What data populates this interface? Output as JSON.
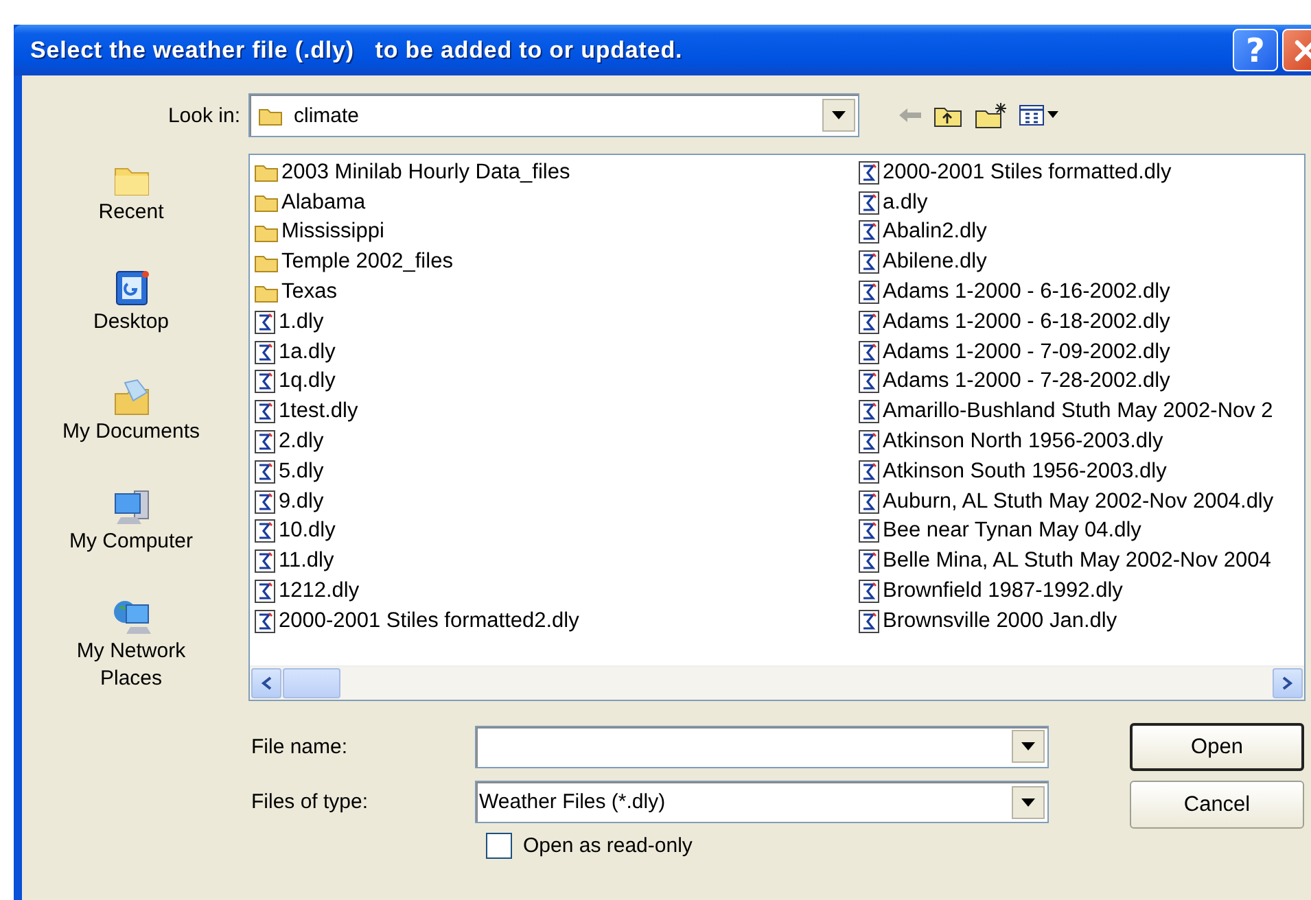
{
  "window": {
    "title": "Select the weather file (.dly)   to be added to or updated.",
    "help_button": "?"
  },
  "look_in": {
    "label": "Look in:",
    "value": "climate"
  },
  "places": [
    {
      "label": "Recent",
      "kind": "recent"
    },
    {
      "label": "Desktop",
      "kind": "desktop"
    },
    {
      "label": "My Documents",
      "kind": "documents"
    },
    {
      "label": "My Computer",
      "kind": "computer"
    },
    {
      "label": "My Network Places",
      "kind": "network"
    }
  ],
  "files": [
    {
      "name": "2003 Minilab Hourly Data_files",
      "kind": "folder"
    },
    {
      "name": "Alabama",
      "kind": "folder"
    },
    {
      "name": "Mississippi",
      "kind": "folder"
    },
    {
      "name": "Temple 2002_files",
      "kind": "folder"
    },
    {
      "name": "Texas",
      "kind": "folder"
    },
    {
      "name": "1.dly",
      "kind": "file"
    },
    {
      "name": "1a.dly",
      "kind": "file"
    },
    {
      "name": "1q.dly",
      "kind": "file"
    },
    {
      "name": "1test.dly",
      "kind": "file"
    },
    {
      "name": "2.dly",
      "kind": "file"
    },
    {
      "name": "5.dly",
      "kind": "file"
    },
    {
      "name": "9.dly",
      "kind": "file"
    },
    {
      "name": "10.dly",
      "kind": "file"
    },
    {
      "name": "11.dly",
      "kind": "file"
    },
    {
      "name": "1212.dly",
      "kind": "file"
    },
    {
      "name": "2000-2001 Stiles formatted2.dly",
      "kind": "file"
    },
    {
      "name": "2000-2001 Stiles formatted.dly",
      "kind": "file"
    },
    {
      "name": "a.dly",
      "kind": "file"
    },
    {
      "name": "Abalin2.dly",
      "kind": "file"
    },
    {
      "name": "Abilene.dly",
      "kind": "file"
    },
    {
      "name": "Adams 1-2000 - 6-16-2002.dly",
      "kind": "file"
    },
    {
      "name": "Adams 1-2000 - 6-18-2002.dly",
      "kind": "file"
    },
    {
      "name": "Adams 1-2000 - 7-09-2002.dly",
      "kind": "file"
    },
    {
      "name": "Adams 1-2000 - 7-28-2002.dly",
      "kind": "file"
    },
    {
      "name": "Amarillo-Bushland Stuth May 2002-Nov 2",
      "kind": "file"
    },
    {
      "name": "Atkinson North 1956-2003.dly",
      "kind": "file"
    },
    {
      "name": "Atkinson South 1956-2003.dly",
      "kind": "file"
    },
    {
      "name": "Auburn, AL Stuth May 2002-Nov 2004.dly",
      "kind": "file"
    },
    {
      "name": "Bee near Tynan May 04.dly",
      "kind": "file"
    },
    {
      "name": "Belle Mina, AL  Stuth May 2002-Nov 2004",
      "kind": "file"
    },
    {
      "name": "Brownfield 1987-1992.dly",
      "kind": "file"
    },
    {
      "name": "Brownsville 2000 Jan.dly",
      "kind": "file"
    }
  ],
  "file_name": {
    "label": "File name:"
  },
  "file_type": {
    "label": "Files of type:",
    "value": "Weather Files (*.dly)"
  },
  "read_only": {
    "label": "Open as read-only",
    "checked": false
  },
  "buttons": [
    {
      "label": "Open",
      "default": true
    },
    {
      "label": "Cancel",
      "default": false
    }
  ]
}
